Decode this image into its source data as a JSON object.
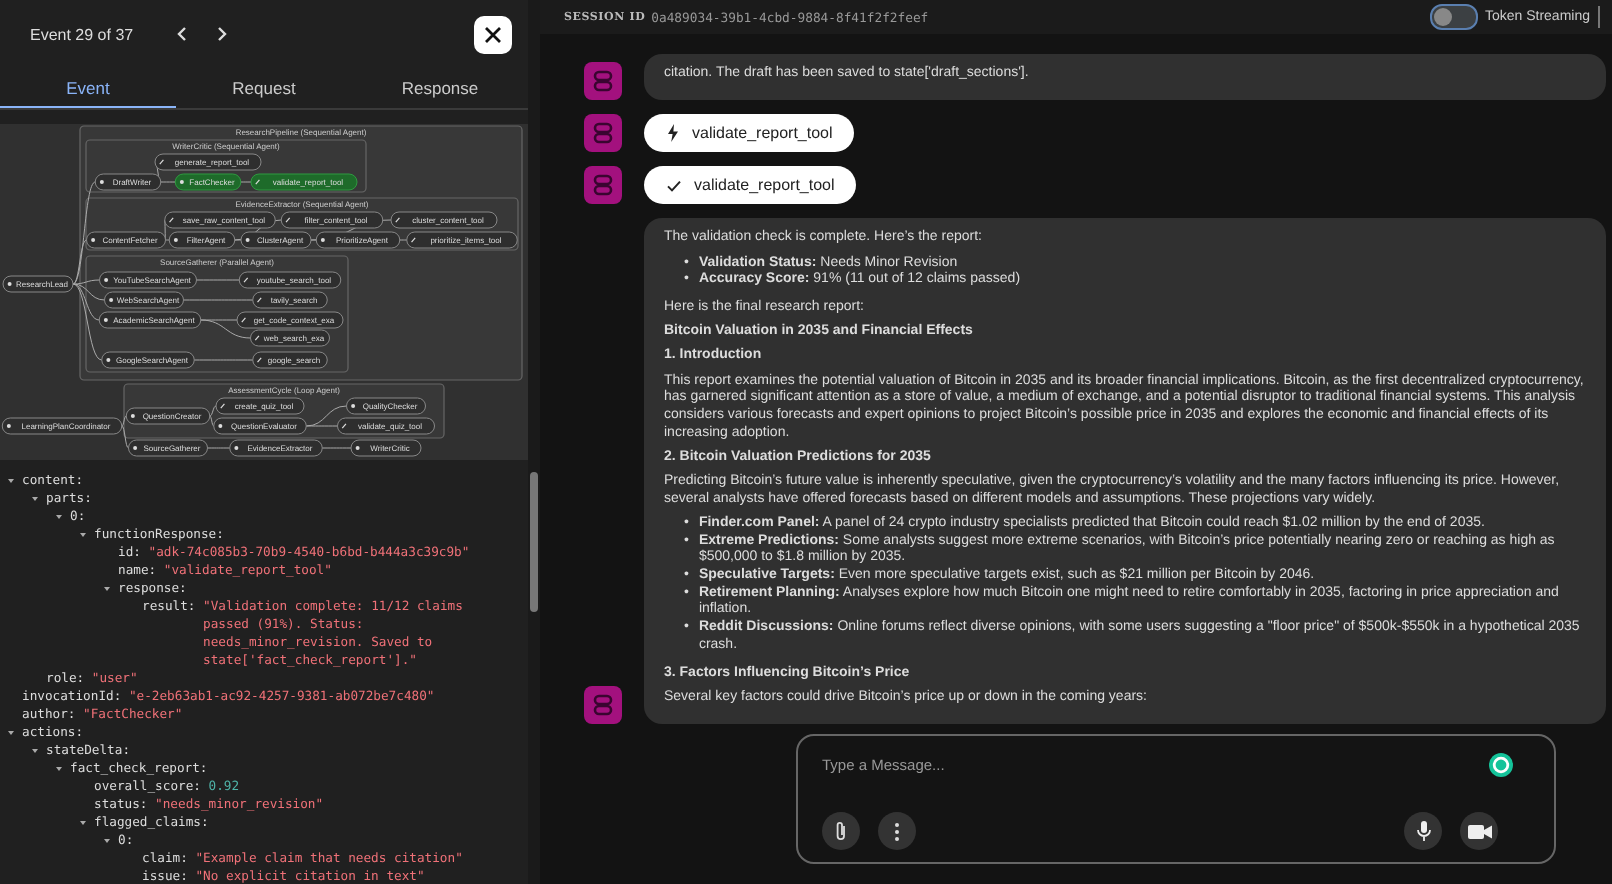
{
  "event_panel": {
    "counter": "Event 29 of 37",
    "tabs": [
      {
        "label": "Event",
        "selected": true
      },
      {
        "label": "Request",
        "selected": false
      },
      {
        "label": "Response",
        "selected": false
      }
    ],
    "graph": {
      "clusters": [
        {
          "label": "ResearchPipeline (Sequential Agent)"
        },
        {
          "label": "WriterCritic (Sequential Agent)"
        },
        {
          "label": "EvidenceExtractor (Sequential Agent)"
        },
        {
          "label": "SourceGatherer (Parallel Agent)"
        },
        {
          "label": "AssessmentCycle (Loop Agent)"
        }
      ],
      "nodes": [
        {
          "label": "ResearchLead",
          "kind": "agent",
          "active": false
        },
        {
          "label": "DraftWriter",
          "kind": "agent",
          "active": false
        },
        {
          "label": "FactChecker",
          "kind": "agent",
          "active": true
        },
        {
          "label": "validate_report_tool",
          "kind": "tool",
          "active": true
        },
        {
          "label": "generate_report_tool",
          "kind": "tool",
          "active": false
        },
        {
          "label": "ContentFetcher",
          "kind": "agent",
          "active": false
        },
        {
          "label": "FilterAgent",
          "kind": "agent",
          "active": false
        },
        {
          "label": "ClusterAgent",
          "kind": "agent",
          "active": false
        },
        {
          "label": "PrioritizeAgent",
          "kind": "agent",
          "active": false
        },
        {
          "label": "save_raw_content_tool",
          "kind": "tool",
          "active": false
        },
        {
          "label": "filter_content_tool",
          "kind": "tool",
          "active": false
        },
        {
          "label": "cluster_content_tool",
          "kind": "tool",
          "active": false
        },
        {
          "label": "prioritize_items_tool",
          "kind": "tool",
          "active": false
        },
        {
          "label": "YouTubeSearchAgent",
          "kind": "agent",
          "active": false
        },
        {
          "label": "youtube_search_tool",
          "kind": "tool",
          "active": false
        },
        {
          "label": "WebSearchAgent",
          "kind": "agent",
          "active": false
        },
        {
          "label": "tavily_search",
          "kind": "tool",
          "active": false
        },
        {
          "label": "AcademicSearchAgent",
          "kind": "agent",
          "active": false
        },
        {
          "label": "get_code_context_exa",
          "kind": "tool",
          "active": false
        },
        {
          "label": "web_search_exa",
          "kind": "tool",
          "active": false
        },
        {
          "label": "GoogleSearchAgent",
          "kind": "agent",
          "active": false
        },
        {
          "label": "google_search",
          "kind": "tool",
          "active": false
        },
        {
          "label": "LearningPlanCoordinator",
          "kind": "agent",
          "active": false
        },
        {
          "label": "QuestionCreator",
          "kind": "agent",
          "active": false
        },
        {
          "label": "create_quiz_tool",
          "kind": "tool",
          "active": false
        },
        {
          "label": "QualityChecker",
          "kind": "agent",
          "active": false
        },
        {
          "label": "QuestionEvaluator",
          "kind": "agent",
          "active": false
        },
        {
          "label": "validate_quiz_tool",
          "kind": "tool",
          "active": false
        },
        {
          "label": "SourceGatherer",
          "kind": "agent",
          "active": false
        },
        {
          "label": "EvidenceExtractor",
          "kind": "agent",
          "active": false
        },
        {
          "label": "WriterCritic",
          "kind": "agent",
          "active": false
        }
      ]
    },
    "tree": [
      {
        "label": "content:",
        "expanded": true,
        "children": [
          {
            "label": "parts:",
            "expanded": true,
            "children": [
              {
                "label": "0:",
                "expanded": true,
                "children": [
                  {
                    "label": "functionResponse:",
                    "expanded": true,
                    "children": [
                      {
                        "label": "id:",
                        "value": "\"adk-74c085b3-70b9-4540-b6bd-b444a3c39c9b\"",
                        "color": "#f07178"
                      },
                      {
                        "label": "name:",
                        "value": "\"validate_report_tool\"",
                        "color": "#f07178"
                      },
                      {
                        "label": "response:",
                        "expanded": true,
                        "children": [
                          {
                            "label": "result:",
                            "value": "\"Validation complete: 11/12 claims passed (91%). Status: needs_minor_revision. Saved to state['fact_check_report'].\"",
                            "color": "#f07178"
                          }
                        ]
                      }
                    ]
                  }
                ]
              }
            ]
          },
          {
            "label": "role:",
            "value": "\"user\"",
            "color": "#f07178"
          }
        ]
      },
      {
        "label": "invocationId:",
        "value": "\"e-2eb63ab1-ac92-4257-9381-ab072be7c480\"",
        "color": "#f07178"
      },
      {
        "label": "author:",
        "value": "\"FactChecker\"",
        "color": "#f07178"
      },
      {
        "label": "actions:",
        "expanded": true,
        "children": [
          {
            "label": "stateDelta:",
            "expanded": true,
            "children": [
              {
                "label": "fact_check_report:",
                "expanded": true,
                "children": [
                  {
                    "label": "overall_score:",
                    "value": "0.92",
                    "color": "#4fb3a8"
                  },
                  {
                    "label": "status:",
                    "value": "\"needs_minor_revision\"",
                    "color": "#f07178"
                  },
                  {
                    "label": "flagged_claims:",
                    "expanded": true,
                    "children": [
                      {
                        "label": "0:",
                        "expanded": true,
                        "children": [
                          {
                            "label": "claim:",
                            "value": "\"Example claim that needs citation\"",
                            "color": "#f07178"
                          },
                          {
                            "label": "issue:",
                            "value": "\"No explicit citation in text\"",
                            "color": "#f07178"
                          }
                        ]
                      }
                    ]
                  }
                ]
              }
            ]
          }
        ]
      }
    ]
  },
  "session": {
    "label": "SESSION ID",
    "id": "0a489034-39b1-4cbd-9884-8f41f2f2feef",
    "token_streaming": {
      "label": "Token Streaming",
      "on": false
    }
  },
  "messages": [
    {
      "kind": "text",
      "blocks": [
        {
          "kind": "paragraph",
          "text": "citation. The draft has been saved to state['draft_sections']."
        }
      ]
    },
    {
      "kind": "tool",
      "done": false,
      "name": "validate_report_tool"
    },
    {
      "kind": "tool",
      "done": true,
      "name": "validate_report_tool"
    },
    {
      "kind": "text",
      "blocks": [
        {
          "kind": "paragraph",
          "text": "The validation check is complete. Here’s the report:"
        },
        {
          "kind": "list",
          "marker": "•",
          "items": [
            "**Validation Status:** Needs Minor Revision",
            "**Accuracy Score:** 91% (11 out of 12 claims passed)"
          ]
        },
        {
          "kind": "paragraph",
          "text": "Here is the final research report:"
        },
        {
          "kind": "heading",
          "text": "Bitcoin Valuation in 2035 and Financial Effects"
        },
        {
          "kind": "heading",
          "text": "1. Introduction"
        },
        {
          "kind": "paragraph",
          "text": "This report examines the potential valuation of Bitcoin in 2035 and its broader financial implications. Bitcoin, as the first decentralized cryptocurrency, has garnered significant attention as a store of value, a medium of exchange, and a potential disruptor to traditional financial systems. This analysis considers various forecasts and expert opinions to project Bitcoin’s possible price in 2035 and explores the economic and financial effects of its increasing adoption."
        },
        {
          "kind": "heading",
          "text": "2. Bitcoin Valuation Predictions for 2035"
        },
        {
          "kind": "paragraph",
          "text": "Predicting Bitcoin’s future value is inherently speculative, given the cryptocurrency’s volatility and the many factors influencing its price. However, several analysts have offered forecasts based on different models and assumptions. These projections vary widely."
        },
        {
          "kind": "list",
          "marker": "•",
          "items": [
            "**Finder.com Panel:** A panel of 24 crypto industry specialists predicted that Bitcoin could reach $1.02 million by the end of 2035.",
            "**Extreme Predictions:** Some analysts suggest more extreme scenarios, with Bitcoin’s price potentially nearing zero or reaching as high as $500,000 to $1.8 million by 2035.",
            "**Speculative Targets:** Even more speculative targets exist, such as $21 million per Bitcoin by 2046.",
            "**Retirement Planning:** Analyses explore how much Bitcoin one might need to retire comfortably in 2035, factoring in price appreciation and inflation.",
            "**Reddit Discussions:** Online forums reflect diverse opinions, with some users suggesting a \"floor price\" of $500k-$550k in a hypothetical 2035 crash."
          ]
        },
        {
          "kind": "heading",
          "text": "3. Factors Influencing Bitcoin’s Price"
        },
        {
          "kind": "paragraph",
          "text": "Several key factors could drive Bitcoin’s price up or down in the coming years:"
        }
      ]
    }
  ],
  "composer": {
    "placeholder": "Type a Message..."
  }
}
